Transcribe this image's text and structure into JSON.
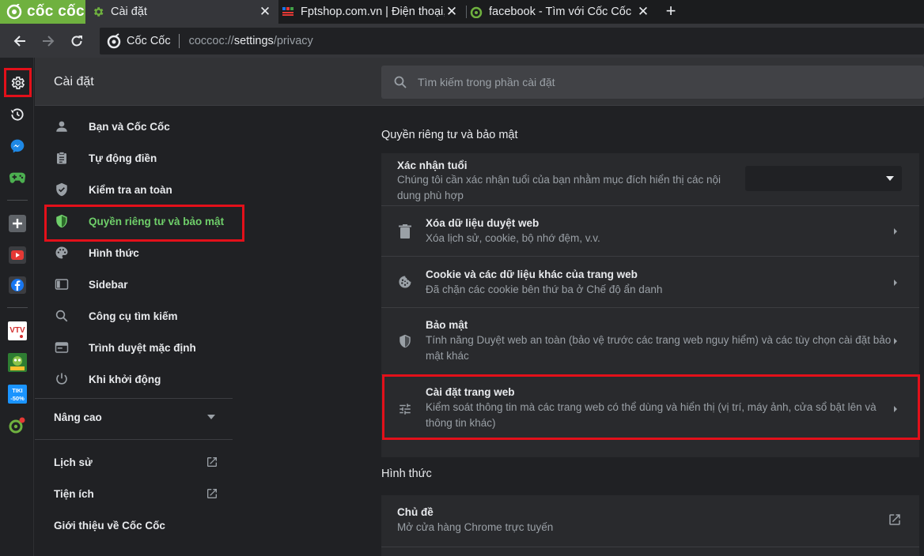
{
  "browser": {
    "brand": "cốc cốc",
    "tabs": [
      {
        "title": "Cài đặt",
        "active": true
      },
      {
        "title": "Fptshop.com.vn | Điện thoại, Laptop",
        "active": false
      },
      {
        "title": "facebook - Tìm với Cốc Cốc",
        "active": false
      }
    ],
    "new_tab": "+",
    "omnibox": {
      "site": "Cốc Cốc",
      "url_scheme": "coccoc://",
      "url_host": "settings",
      "url_path": "/privacy"
    }
  },
  "sidebar_icons": [
    "settings-icon",
    "history-icon",
    "messenger-icon",
    "gamepad-icon",
    "add-icon",
    "youtube-icon",
    "facebook-icon",
    "vtv-go-icon",
    "game-app-icon",
    "tiki-icon",
    "coccoc-map-icon"
  ],
  "sidebar_badges": {
    "vtv": "VTV",
    "tiki": "TIKI",
    "tiki_discount": "-50%"
  },
  "header": {
    "title": "Cài đặt",
    "search_placeholder": "Tìm kiếm trong phần cài đặt"
  },
  "nav": {
    "items": [
      {
        "label": "Bạn và Cốc Cốc",
        "icon": "person-icon"
      },
      {
        "label": "Tự động điền",
        "icon": "clipboard-icon"
      },
      {
        "label": "Kiểm tra an toàn",
        "icon": "shield-check-icon"
      },
      {
        "label": "Quyền riêng tư và bảo mật",
        "icon": "shield-icon",
        "selected": true
      },
      {
        "label": "Hình thức",
        "icon": "palette-icon"
      },
      {
        "label": "Sidebar",
        "icon": "sidebar-icon"
      },
      {
        "label": "Công cụ tìm kiếm",
        "icon": "search-icon"
      },
      {
        "label": "Trình duyệt mặc định",
        "icon": "browser-icon"
      },
      {
        "label": "Khi khởi động",
        "icon": "power-icon"
      }
    ],
    "advanced": "Nâng cao",
    "history": "Lịch sử",
    "extensions": "Tiện ích",
    "about": "Giới thiệu về Cốc Cốc"
  },
  "privacy": {
    "section_title": "Quyền riêng tư và bảo mật",
    "age": {
      "title": "Xác nhận tuổi",
      "desc_line1": "Chúng tôi cần xác nhận tuổi của bạn nhằm mục đích hiển thị các nội",
      "desc_line2": "dung phù hợp",
      "dropdown_value": ""
    },
    "rows": [
      {
        "title": "Xóa dữ liệu duyệt web",
        "desc": "Xóa lịch sử, cookie, bộ nhớ đệm, v.v.",
        "icon": "trash-icon"
      },
      {
        "title": "Cookie và các dữ liệu khác của trang web",
        "desc": "Đã chặn các cookie bên thứ ba ở Chế độ ẩn danh",
        "icon": "cookie-icon"
      },
      {
        "title": "Bảo mật",
        "desc_line1": "Tính năng Duyệt web an toàn (bảo vệ trước các trang web nguy hiểm) và các tùy chọn cài đặt bảo",
        "desc_line2": "mật khác",
        "icon": "security-shield-icon"
      },
      {
        "title": "Cài đặt trang web",
        "desc_line1": "Kiểm soát thông tin mà các trang web có thể dùng và hiển thị (vị trí, máy ảnh, cửa sổ bật lên và",
        "desc_line2": "thông tin khác)",
        "icon": "tune-icon"
      }
    ]
  },
  "appearance": {
    "section_title": "Hình thức",
    "theme_title": "Chủ đề",
    "theme_desc": "Mở cửa hàng Chrome trực tuyến"
  },
  "colors": {
    "accent_green": "#6fb13f",
    "highlight_red": "#e3101a",
    "selected_text": "#6fcf6a"
  }
}
